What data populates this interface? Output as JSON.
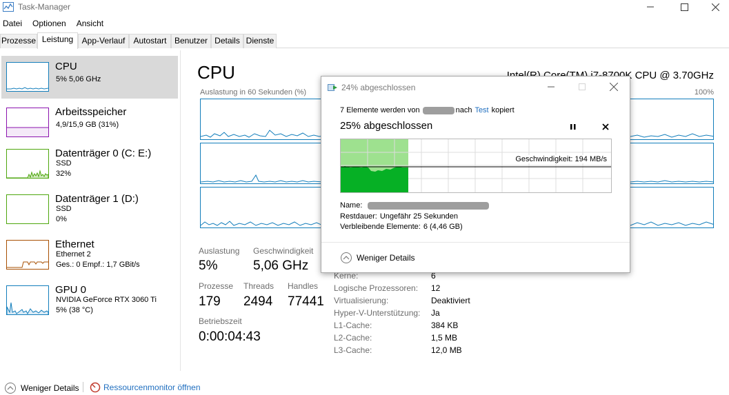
{
  "window": {
    "title": "Task-Manager"
  },
  "menu": [
    "Datei",
    "Optionen",
    "Ansicht"
  ],
  "tabs": [
    "Prozesse",
    "Leistung",
    "App-Verlauf",
    "Autostart",
    "Benutzer",
    "Details",
    "Dienste"
  ],
  "active_tab": "Leistung",
  "sidebar": {
    "items": [
      {
        "name": "CPU",
        "lines": [
          "5% 5,06 GHz"
        ],
        "color": "#117dbb",
        "icon": "cpu-graph-icon"
      },
      {
        "name": "Arbeitsspeicher",
        "lines": [
          "4,9/15,9 GB (31%)"
        ],
        "color": "#8b12ae",
        "icon": "memory-graph-icon"
      },
      {
        "name": "Datenträger 0 (C: E:)",
        "lines": [
          "SSD",
          "32%"
        ],
        "color": "#4da60c",
        "icon": "disk-graph-icon"
      },
      {
        "name": "Datenträger 1 (D:)",
        "lines": [
          "SSD",
          "0%"
        ],
        "color": "#4da60c",
        "icon": "disk-graph-icon"
      },
      {
        "name": "Ethernet",
        "lines": [
          "Ethernet 2",
          "Ges.: 0 Empf.: 1,7 GBit/s"
        ],
        "color": "#a74f01",
        "icon": "ethernet-graph-icon"
      },
      {
        "name": "GPU 0",
        "lines": [
          "NVIDIA GeForce RTX 3060 Ti",
          "5% (38 °C)"
        ],
        "color": "#117dbb",
        "icon": "gpu-graph-icon"
      }
    ]
  },
  "main": {
    "title": "CPU",
    "model": "Intel(R) Core(TM) i7-8700K CPU @ 3.70GHz",
    "graph_label": "Auslastung in 60 Sekunden (%)",
    "graph_max": "100%",
    "stats": {
      "auslastung_label": "Auslastung",
      "auslastung_value": "5%",
      "geschw_label": "Geschwindigkeit",
      "geschw_value": "5,06 GHz",
      "prozesse_label": "Prozesse",
      "prozesse_value": "179",
      "threads_label": "Threads",
      "threads_value": "2494",
      "handles_label": "Handles",
      "handles_value": "77441",
      "betriebszeit_label": "Betriebszeit",
      "betriebszeit_value": "0:00:04:43"
    },
    "info": [
      {
        "label": "Kerne:",
        "value": "6"
      },
      {
        "label": "Logische Prozessoren:",
        "value": "12"
      },
      {
        "label": "Virtualisierung:",
        "value": "Deaktiviert"
      },
      {
        "label": "Hyper-V-Unterstützung:",
        "value": "Ja"
      },
      {
        "label": "L1-Cache:",
        "value": "384 KB"
      },
      {
        "label": "L2-Cache:",
        "value": "1,5 MB"
      },
      {
        "label": "L3-Cache:",
        "value": "12,0 MB"
      }
    ]
  },
  "footer": {
    "less_details": "Weniger Details",
    "resource_monitor": "Ressourcenmonitor öffnen"
  },
  "copy_dialog": {
    "title": "24% abgeschlossen",
    "line_prefix": "7 Elemente werden von",
    "line_mid": "nach",
    "line_target": "Test",
    "line_suffix": "kopiert",
    "percent": "25% abgeschlossen",
    "progress_fraction": 0.25,
    "speed": "Geschwindigkeit: 194 MB/s",
    "name_label": "Name:",
    "remaining_label": "Restdauer:",
    "remaining_value": "Ungefähr 25 Sekunden",
    "items_label": "Verbleibende Elemente:",
    "items_value": "6 (4,46 GB)",
    "less_details": "Weniger Details",
    "accent": "#06b025"
  }
}
